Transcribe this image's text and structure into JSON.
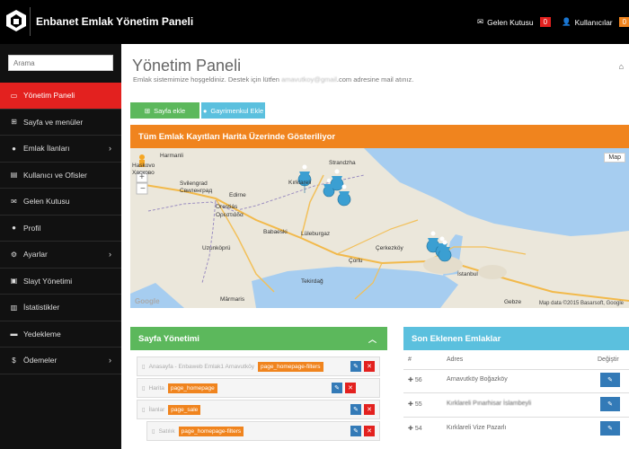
{
  "header": {
    "brand": "Enbanet Emlak Yönetim Paneli",
    "inbox_label": "Gelen Kutusu",
    "inbox_count": "0",
    "users_label": "Kullanıcılar",
    "users_count": "0"
  },
  "sidebar": {
    "search_placeholder": "Arama",
    "items": [
      {
        "label": "Yönetim Paneli",
        "icon": "monitor-icon"
      },
      {
        "label": "Sayfa ve menüler",
        "icon": "sitemap-icon"
      },
      {
        "label": "Emlak İlanları",
        "icon": "map-marker-icon"
      },
      {
        "label": "Kullanıcı ve Ofisler",
        "icon": "id-card-icon"
      },
      {
        "label": "Gelen Kutusu",
        "icon": "envelope-icon"
      },
      {
        "label": "Profil",
        "icon": "user-icon"
      },
      {
        "label": "Ayarlar",
        "icon": "cogs-icon"
      },
      {
        "label": "Slayt Yönetimi",
        "icon": "image-icon"
      },
      {
        "label": "İstatistikler",
        "icon": "stats-icon"
      },
      {
        "label": "Yedekleme",
        "icon": "hdd-icon"
      },
      {
        "label": "Ödemeler",
        "icon": "dollar-icon"
      }
    ]
  },
  "main": {
    "title": "Yönetim Paneli",
    "subtitle_pre": "Emlak sistemimize hoşgeldiniz. Destek için lütfen",
    "subtitle_email": "amavutkoy@gmail",
    "subtitle_post": ".com adresine mail atınız.",
    "btn_add_page": "Sayfa ekle",
    "btn_add_property": "Gayrimenkul Ekle",
    "map_title": "Tüm Emlak Kayıtları Harita Üzerinde Gösteriliyor",
    "map_type": "Map",
    "map_credit": "Map data ©2015 Basarsoft, Google",
    "map_watermark": "Google",
    "map_labels": [
      "Harmanli",
      "Haskovo",
      "Хасково",
      "Svilengrad",
      "Свиленград",
      "Edirne",
      "Kırklareli",
      "Strandzha",
      "Orestiás",
      "Ορεστιάδα",
      "Babaeski",
      "Lüleburgaz",
      "Uzunköprü",
      "Çerkezköy",
      "Çorlu",
      "Tekirdağ",
      "İstanbul",
      "Gebze",
      "Mârmaris"
    ]
  },
  "pages_panel": {
    "title": "Sayfa Yönetimi",
    "rows": [
      {
        "text": "Anasayfa - Enbaweb Emlak1 Arnavutköy",
        "tag": "page_homepage-filters"
      },
      {
        "text": "Harita",
        "tag": "page_homepage"
      },
      {
        "text": "İlanlar",
        "tag": "page_sale"
      },
      {
        "text": "Satılık",
        "tag": "page_homepage-filters"
      }
    ]
  },
  "recent_panel": {
    "title": "Son Eklenen Emlaklar",
    "col_no": "#",
    "col_address": "Adres",
    "col_change": "Değiştir",
    "rows": [
      {
        "no": "56",
        "address": "Arnavutköy Boğazköy"
      },
      {
        "no": "55",
        "address": "Kırklareli Pınarhisar İslambeyli"
      },
      {
        "no": "54",
        "address": "Kırklareli Vize Pazarlı"
      }
    ]
  }
}
